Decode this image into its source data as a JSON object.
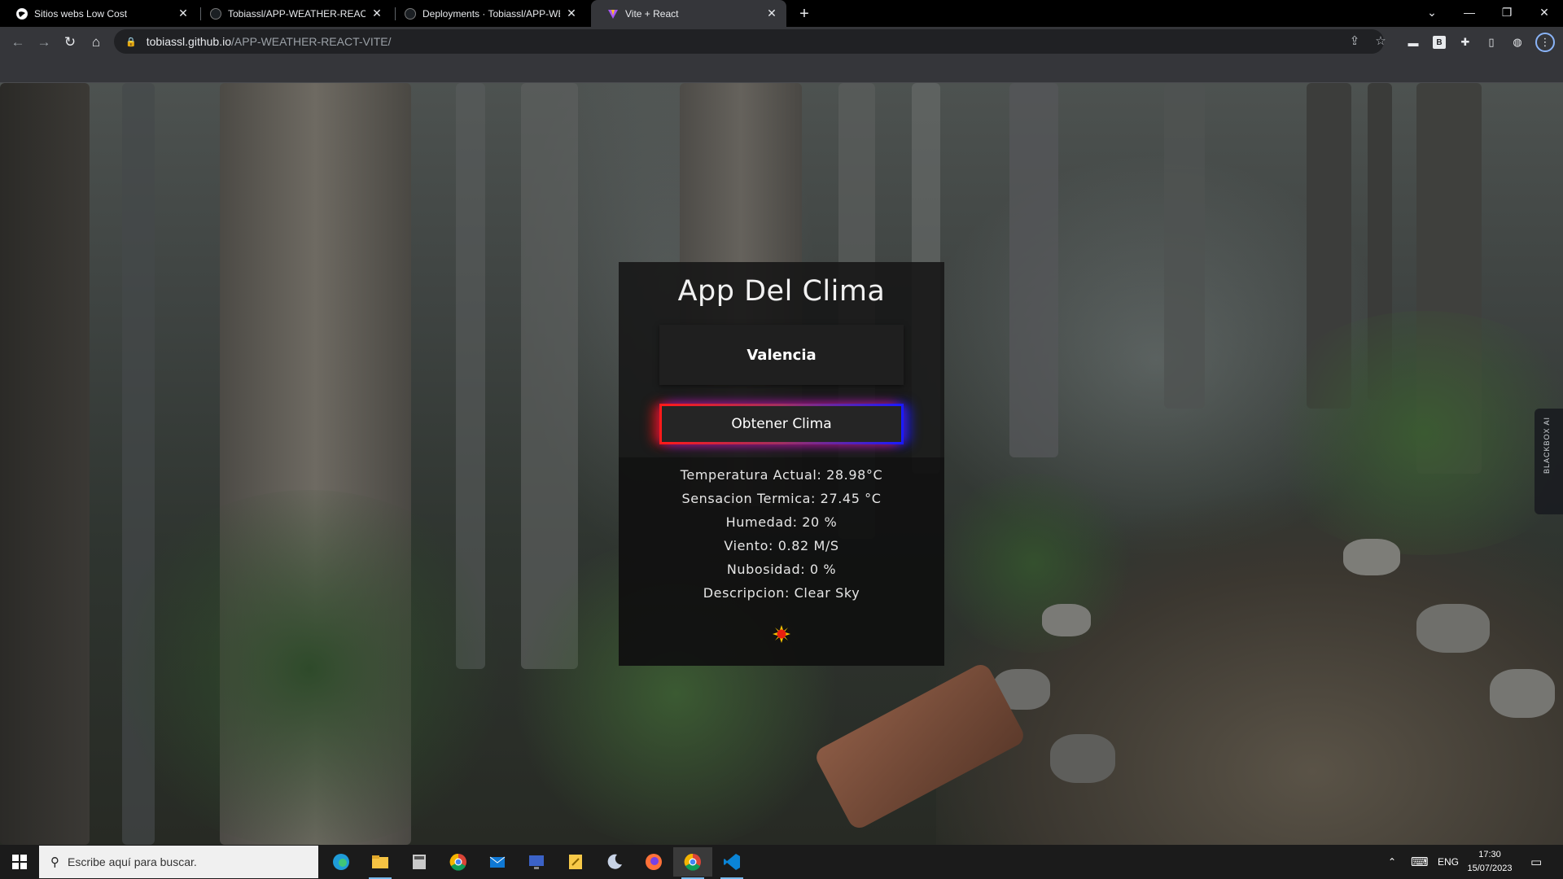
{
  "browser": {
    "tabs": [
      {
        "title": "Sitios webs Low Cost",
        "icon": "globe-icon"
      },
      {
        "title": "Tobiassl/APP-WEATHER-REACT-V",
        "icon": "github-icon"
      },
      {
        "title": "Deployments · Tobiassl/APP-WE",
        "icon": "github-icon"
      },
      {
        "title": "Vite + React",
        "icon": "vite-icon",
        "active": true
      }
    ],
    "url_host": "tobiassl.github.io",
    "url_path": "/APP-WEATHER-REACT-VITE/"
  },
  "app": {
    "title": "App Del Clima",
    "city_value": "Valencia",
    "button_label": "Obtener Clima",
    "weather": {
      "temperature": "Temperatura Actual: 28.98°C",
      "feels_like": "Sensacion Termica: 27.45 °C",
      "humidity": "Humedad: 20 %",
      "wind": "Viento: 0.82 M/S",
      "clouds": "Nubosidad: 0 %",
      "description": "Descripcion: Clear Sky"
    },
    "weather_icon": "sun-icon"
  },
  "side_widget": {
    "label": "BLACKBOX AI"
  },
  "taskbar": {
    "search_placeholder": "Escribe aquí para buscar.",
    "language": "ENG",
    "time": "17:30",
    "date": "15/07/2023"
  },
  "colors": {
    "button_glow_left": "#ff1a1a",
    "button_glow_right": "#1a1aff",
    "card_bg": "#161616"
  }
}
